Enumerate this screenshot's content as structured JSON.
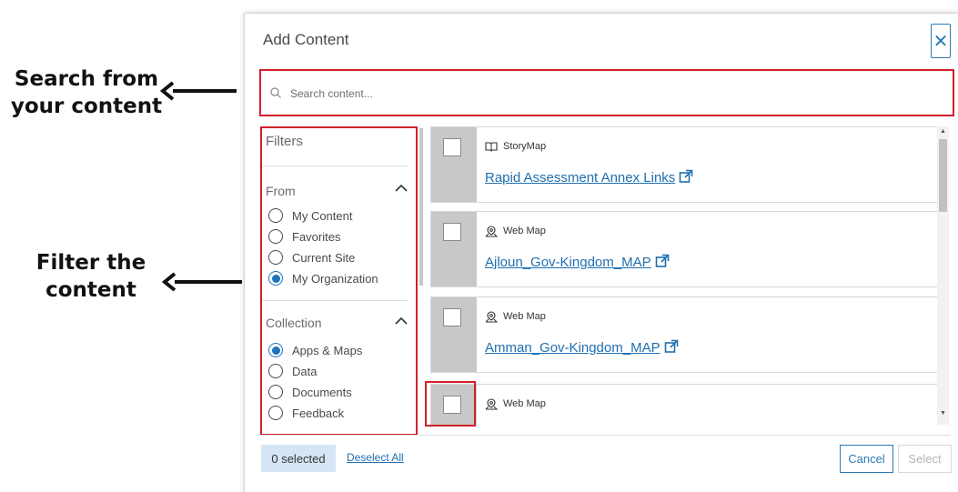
{
  "annotations": {
    "search_line1": "Search from",
    "search_line2": "your content",
    "filter_line1": "Filter the",
    "filter_line2": "content"
  },
  "dialog": {
    "title": "Add Content",
    "close_icon": "close-icon"
  },
  "search": {
    "placeholder": "Search content...",
    "value": ""
  },
  "filters": {
    "title": "Filters",
    "groups": [
      {
        "title": "From",
        "expanded": true,
        "options": [
          {
            "label": "My Content",
            "selected": false
          },
          {
            "label": "Favorites",
            "selected": false
          },
          {
            "label": "Current Site",
            "selected": false
          },
          {
            "label": "My Organization",
            "selected": true
          }
        ]
      },
      {
        "title": "Collection",
        "expanded": true,
        "options": [
          {
            "label": "Apps & Maps",
            "selected": true
          },
          {
            "label": "Data",
            "selected": false
          },
          {
            "label": "Documents",
            "selected": false
          },
          {
            "label": "Feedback",
            "selected": false
          }
        ]
      }
    ]
  },
  "results": [
    {
      "type": "StoryMap",
      "icon": "storymap-icon",
      "title": "Rapid Assessment Annex Links",
      "checked": false
    },
    {
      "type": "Web Map",
      "icon": "web-map-icon",
      "title": "Ajloun_Gov-Kingdom_MAP",
      "checked": false
    },
    {
      "type": "Web Map",
      "icon": "web-map-icon",
      "title": "Amman_Gov-Kingdom_MAP",
      "checked": false
    },
    {
      "type": "Web Map",
      "icon": "web-map-icon",
      "title": "",
      "checked": false
    }
  ],
  "footer": {
    "selected_label": "0 selected",
    "deselect_label": "Deselect All",
    "cancel_label": "Cancel",
    "select_label": "Select"
  },
  "colors": {
    "highlight": "#d0202a",
    "accent": "#1d73bd",
    "link": "#1f6fb0"
  }
}
